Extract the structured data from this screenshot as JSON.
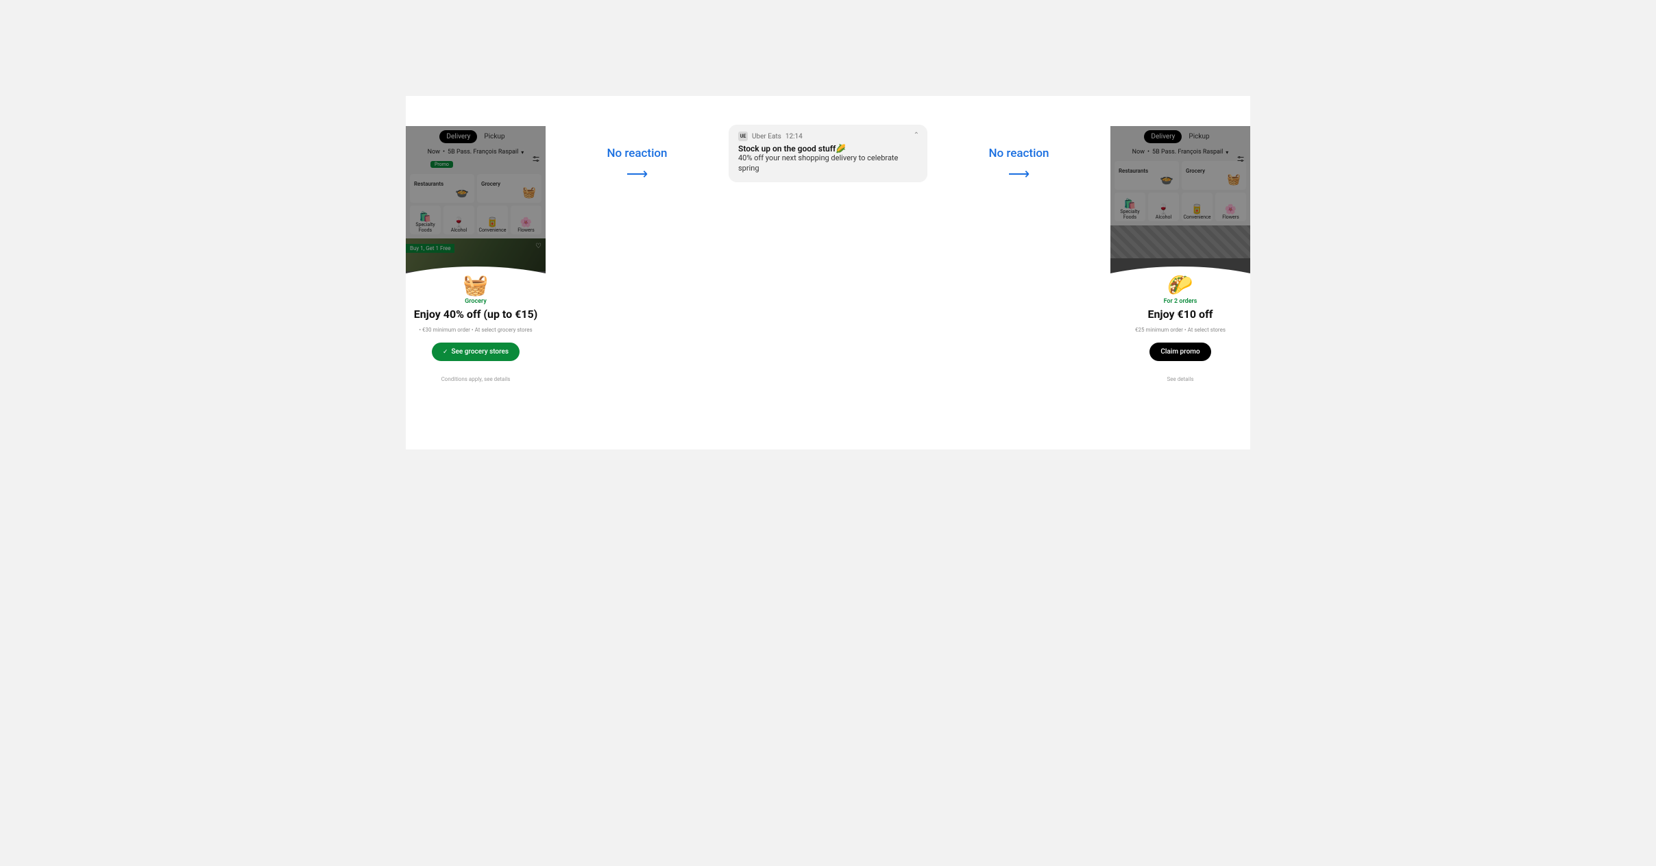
{
  "flow": {
    "label1": "No reaction",
    "label2": "No reaction"
  },
  "notification": {
    "app_badge": "UE",
    "app_name": "Uber Eats",
    "time": "12:14",
    "title": "Stock up on the good stuff🌽",
    "body": "40% off your next shopping delivery to celebrate spring"
  },
  "phone": {
    "tabs": {
      "delivery": "Delivery",
      "pickup": "Pickup"
    },
    "address_prefix": "Now",
    "address": "5B Pass. François Raspail",
    "promo_chip": "Promo",
    "categories": {
      "restaurants": "Restaurants",
      "grocery": "Grocery",
      "specialty": "Specialty Foods",
      "alcohol": "Alcohol",
      "convenience": "Convenience",
      "flowers": "Flowers"
    },
    "bogo": "Buy 1, Get 1 Free"
  },
  "sheet1": {
    "eyebrow": "Grocery",
    "title": "Enjoy 40% off (up to €15)",
    "sub": "• €30 minimum order • At select grocery stores",
    "cta": "See grocery stores",
    "foot": "Conditions apply, see details"
  },
  "sheet2": {
    "eyebrow": "For 2 orders",
    "title": "Enjoy €10 off",
    "sub": "€25 minimum order • At select stores",
    "cta": "Claim promo",
    "foot": "See details"
  }
}
